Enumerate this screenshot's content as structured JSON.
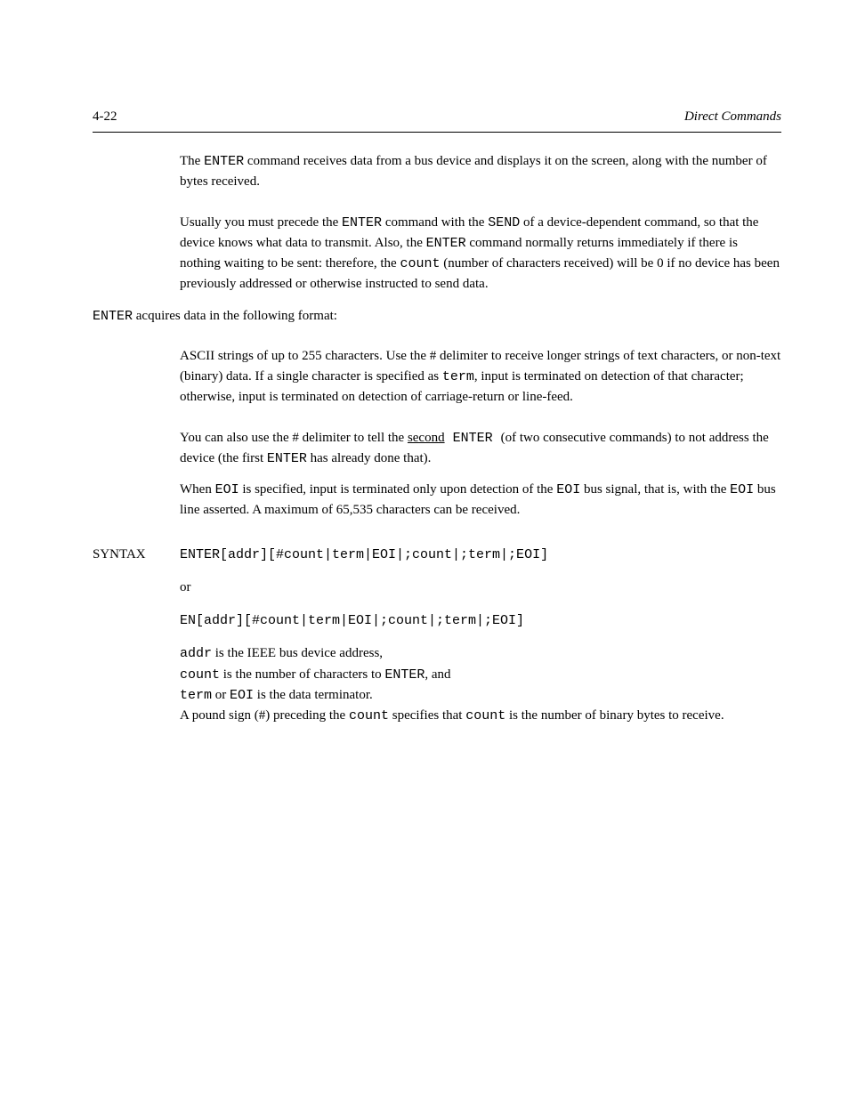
{
  "page": {
    "number": "4-22",
    "header": "Direct Commands"
  },
  "body": {
    "p1_pre": "The ",
    "p1_enter": "ENTER",
    "p1_post": " command receives data from a bus device and displays it on the screen, along with the number of bytes received.",
    "p2_a": "Usually you must precede the ",
    "p2_enter": "ENTER",
    "p2_b": " command with the ",
    "p2_send": "SEND",
    "p2_c": " of a device-dependent command, so that the device knows what data to transmit. Also, the ",
    "p2_enter2": "ENTER",
    "p2_d": " command normally returns immediately if there is nothing waiting to be sent: therefore, the ",
    "p2_count": "count",
    "p2_e": " (number of characters received) will be 0 if no device has been previously addressed or otherwise instructed to send data.",
    "p3_enter": "ENTER",
    "p3_post": " acquires data in the following format:",
    "p4": "ASCII strings of up to 255 characters. Use the # delimiter to receive longer strings of text characters, or non-text (binary) data. If a single character is specified as ",
    "p4_term": "term",
    "p4_b": ", input is terminated on detection of that character; otherwise, input is terminated on detection of carriage-return or line-feed.",
    "p5_a": "You can also use the # delimiter to tell the ",
    "p5_underline": "second",
    "p5_enter1": " ENTER ",
    "p5_b": "(of two consecutive commands) to not address the device (the first ",
    "p5_enter2": "ENTER",
    "p5_c": " has already done that).",
    "p6_a": "When ",
    "p6_eoi": "EOI",
    "p6_b": " is specified, input is terminated only upon detection of the ",
    "p6_eoi2": "EOI",
    "p6_c": " bus signal, that is, with the ",
    "p6_eoi3": "EOI",
    "p6_d": " bus line asserted. A maximum of 65,535 characters can be received.",
    "syntax_label": "SYNTAX",
    "syntax_line1": "ENTER[addr][#count|term|EOI|;count|;term|;EOI]",
    "syntax_or": "or",
    "syntax_line2": "EN[addr][#count|term|EOI|;count|;term|;EOI]",
    "def_addr_k": "addr",
    "def_addr_v": " is the IEEE bus device address,",
    "def_count_k": "count",
    "def_count_v": " is the number of characters to ",
    "def_count_enter": "ENTER",
    "def_count_v2": ", and",
    "def_term_k": "term",
    "def_term_or": " or ",
    "def_eoi_k": "EOI",
    "def_term_v": " is the data terminator.",
    "p7_a": "A pound sign (#) preceding the ",
    "p7_count": "count",
    "p7_b": " specifies that ",
    "p7_count2": "count",
    "p7_c": " is the number of binary bytes to receive."
  }
}
